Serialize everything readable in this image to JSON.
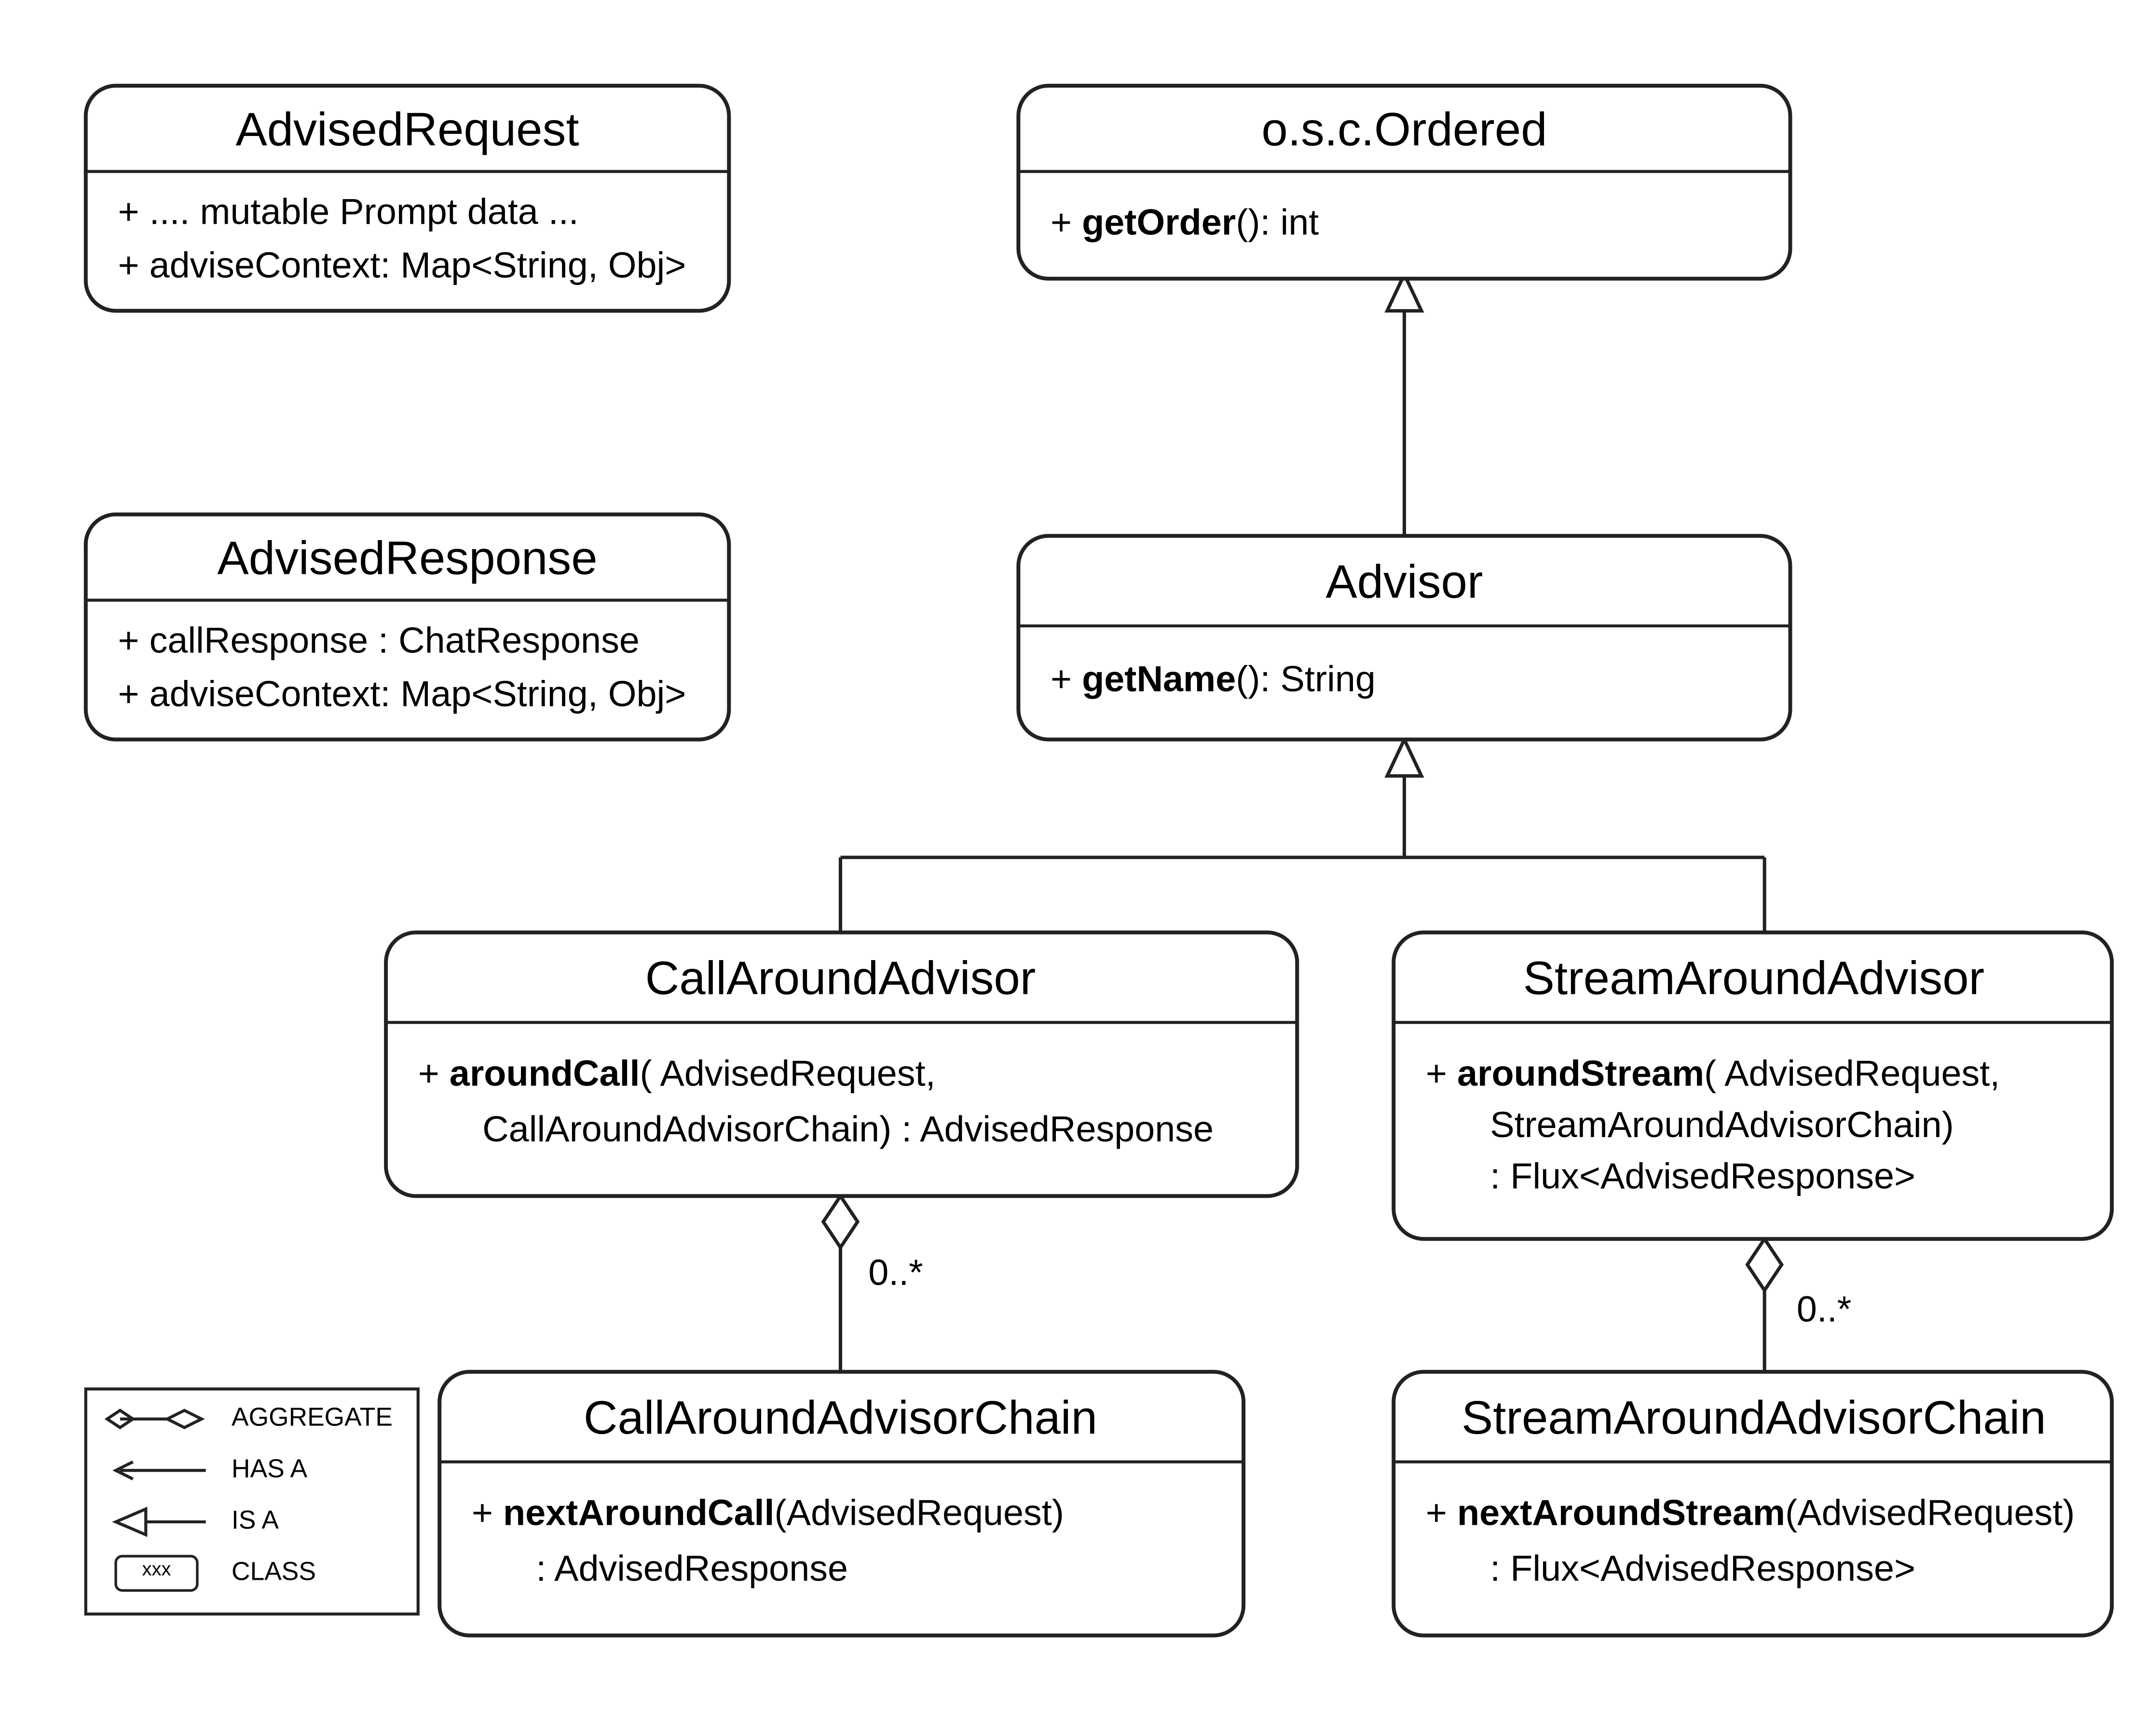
{
  "classes": {
    "advisedRequest": {
      "title": "AdvisedRequest",
      "attr1": "+ .... mutable Prompt data ...",
      "attr2": "+ adviseContext: Map<String, Obj>"
    },
    "advisedResponse": {
      "title": "AdvisedResponse",
      "attr1": "+ callResponse : ChatResponse",
      "attr2": "+ adviseContext: Map<String, Obj>"
    },
    "ordered": {
      "title": "o.s.c.Ordered",
      "opName": "getOrder",
      "opSig": "(): int"
    },
    "advisor": {
      "title": "Advisor",
      "opName": "getName",
      "opSig": "(): String"
    },
    "callAroundAdvisor": {
      "title": "CallAroundAdvisor",
      "opName": "aroundCall",
      "opSigL1": "( AdvisedRequest,",
      "opSigL2": "CallAroundAdvisorChain) : AdvisedResponse"
    },
    "streamAroundAdvisor": {
      "title": "StreamAroundAdvisor",
      "opName": "aroundStream",
      "opSigL1": "( AdvisedRequest,",
      "opSigL2": "StreamAroundAdvisorChain)",
      "opSigL3": ": Flux<AdvisedResponse>"
    },
    "callAroundAdvisorChain": {
      "title": "CallAroundAdvisorChain",
      "opName": "nextAroundCall",
      "opSigL1": "(AdvisedRequest)",
      "opSigL2": ": AdvisedResponse"
    },
    "streamAroundAdvisorChain": {
      "title": "StreamAroundAdvisorChain",
      "opName": "nextAroundStream",
      "opSigL1": "(AdvisedRequest)",
      "opSigL2": ": Flux<AdvisedResponse>"
    }
  },
  "multiplicity": {
    "callChain": "0..*",
    "streamChain": "0..*"
  },
  "legend": {
    "aggregate": "AGGREGATE",
    "hasA": "HAS A",
    "isA": "IS A",
    "class": "CLASS",
    "classSample": "xxx"
  }
}
